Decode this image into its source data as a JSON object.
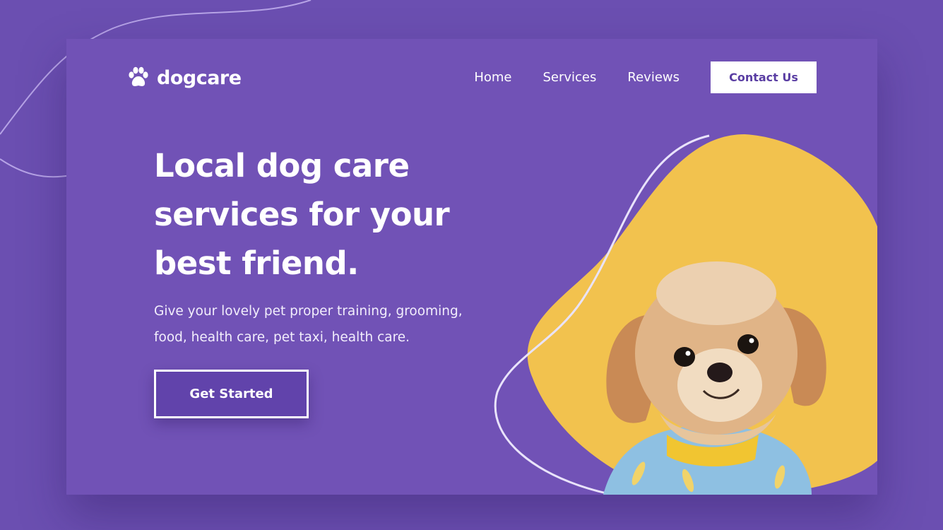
{
  "brand": {
    "name": "dogcare",
    "icon": "paw-icon"
  },
  "nav": {
    "items": [
      "Home",
      "Services",
      "Reviews"
    ],
    "contact_label": "Contact Us"
  },
  "hero": {
    "title_lines": [
      "Local dog care",
      "services for your",
      "best friend."
    ],
    "subtitle_lines": [
      "Give your lovely pet proper training, grooming,",
      "food, health care, pet taxi, health care."
    ],
    "cta_label": "Get Started",
    "image": "puppy-photo"
  },
  "colors": {
    "background": "#6b4fb1",
    "card": "#7152b6",
    "accent_yellow": "#f2c24e",
    "button_text": "#5a3ea3"
  }
}
